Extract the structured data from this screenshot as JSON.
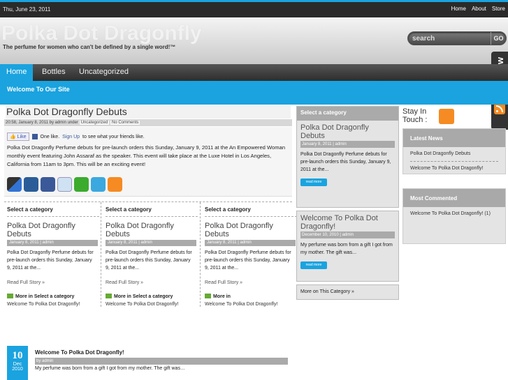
{
  "topbar": {
    "date": "Thu, June 23, 2011",
    "links": [
      "Home",
      "About",
      "Store"
    ]
  },
  "header": {
    "title": "Polka Dot Dragonfly",
    "tagline": "The perfume for women who can't be defined by a single word!™"
  },
  "search": {
    "placeholder": "search",
    "go": "GO"
  },
  "nav": {
    "items": [
      "Home",
      "Bottles",
      "Uncategorized"
    ]
  },
  "welcome": "Welcome To Our Site",
  "follow": "follow",
  "post": {
    "title": "Polka Dot Dragonfly Debuts",
    "meta_prefix": "20:58, January 8, 2011 by admin under",
    "meta_category": "Uncategorized",
    "meta_comments": "No Comments",
    "like_button": "Like",
    "like_text_1": "One like.",
    "like_signup": "Sign Up",
    "like_text_2": "to see what your friends like.",
    "body": "Polka Dot Dragonfly Perfume debuts for pre-launch orders this Sunday, January 9, 2011 at the An Empowered Woman monthly event featuring John Assaraf as the speaker. This event will take place at the Luxe Hotel in Los Angeles, California from 11am to 3pm. This will be an exciting event!"
  },
  "category_columns": [
    {
      "header": "Select a category",
      "title": "Polka Dot Dragonfly Debuts",
      "date": "January 8, 2011 | admin",
      "excerpt": "Polka Dot Dragonfly Perfume debuts for pre-launch orders this Sunday, January 9, 2011 at the...",
      "read_more": "Read Full Story »",
      "more_in": "More in Select a category",
      "more_link": "Welcome To Polka Dot Dragonfly!"
    },
    {
      "header": "Select a category",
      "title": "Polka Dot Dragonfly Debuts",
      "date": "January 8, 2011 | admin",
      "excerpt": "Polka Dot Dragonfly Perfume debuts for pre-launch orders this Sunday, January 9, 2011 at the...",
      "read_more": "Read Full Story »",
      "more_in": "More in Select a category",
      "more_link": "Welcome To Polka Dot Dragonfly!"
    },
    {
      "header": "Select a category",
      "title": "Polka Dot Dragonfly Debuts",
      "date": "January 8, 2011 | admin",
      "excerpt": "Polka Dot Dragonfly Perfume debuts for pre-launch orders this Sunday, January 9, 2011 at the...",
      "read_more": "Read Full Story »",
      "more_in": "More in",
      "more_link": "Welcome To Polka Dot Dragonfly!"
    }
  ],
  "recent": {
    "day": "10",
    "month": "Dec",
    "year": "2010",
    "title": "Welcome To Polka Dot Dragonfly!",
    "byline": "by admin",
    "excerpt": "My perfume was born from a gift I got from my mother. The gift was…"
  },
  "middle": {
    "header": "Select a category",
    "item1": {
      "title": "Polka Dot Dragonfly Debuts",
      "date": "January 8, 2011 | admin",
      "excerpt": "Polka Dot Dragonfly Perfume debuts for pre-launch orders this Sunday, January 9, 2011 at the...",
      "button": "read more"
    },
    "item2": {
      "title": "Welcome To Polka Dot Dragonfly!",
      "date": "December 10, 2010 | admin",
      "excerpt": "My perfume was born from a gift I got from my mother. The gift was...",
      "button": "read more"
    },
    "more": "More on This Category »"
  },
  "right": {
    "stay": "Stay In Touch :",
    "latest_header": "Latest News",
    "latest": [
      "Polka Dot Dragonfly Debuts",
      "Welcome To Polka Dot Dragonfly!"
    ],
    "commented_header": "Most Commented",
    "commented": [
      "Welcome To Polka Dot Dragonfly! (1)"
    ]
  },
  "colors": {
    "accent": "#1aa3df",
    "dark": "#2a2a2a",
    "gray": "#aaaaaa"
  }
}
